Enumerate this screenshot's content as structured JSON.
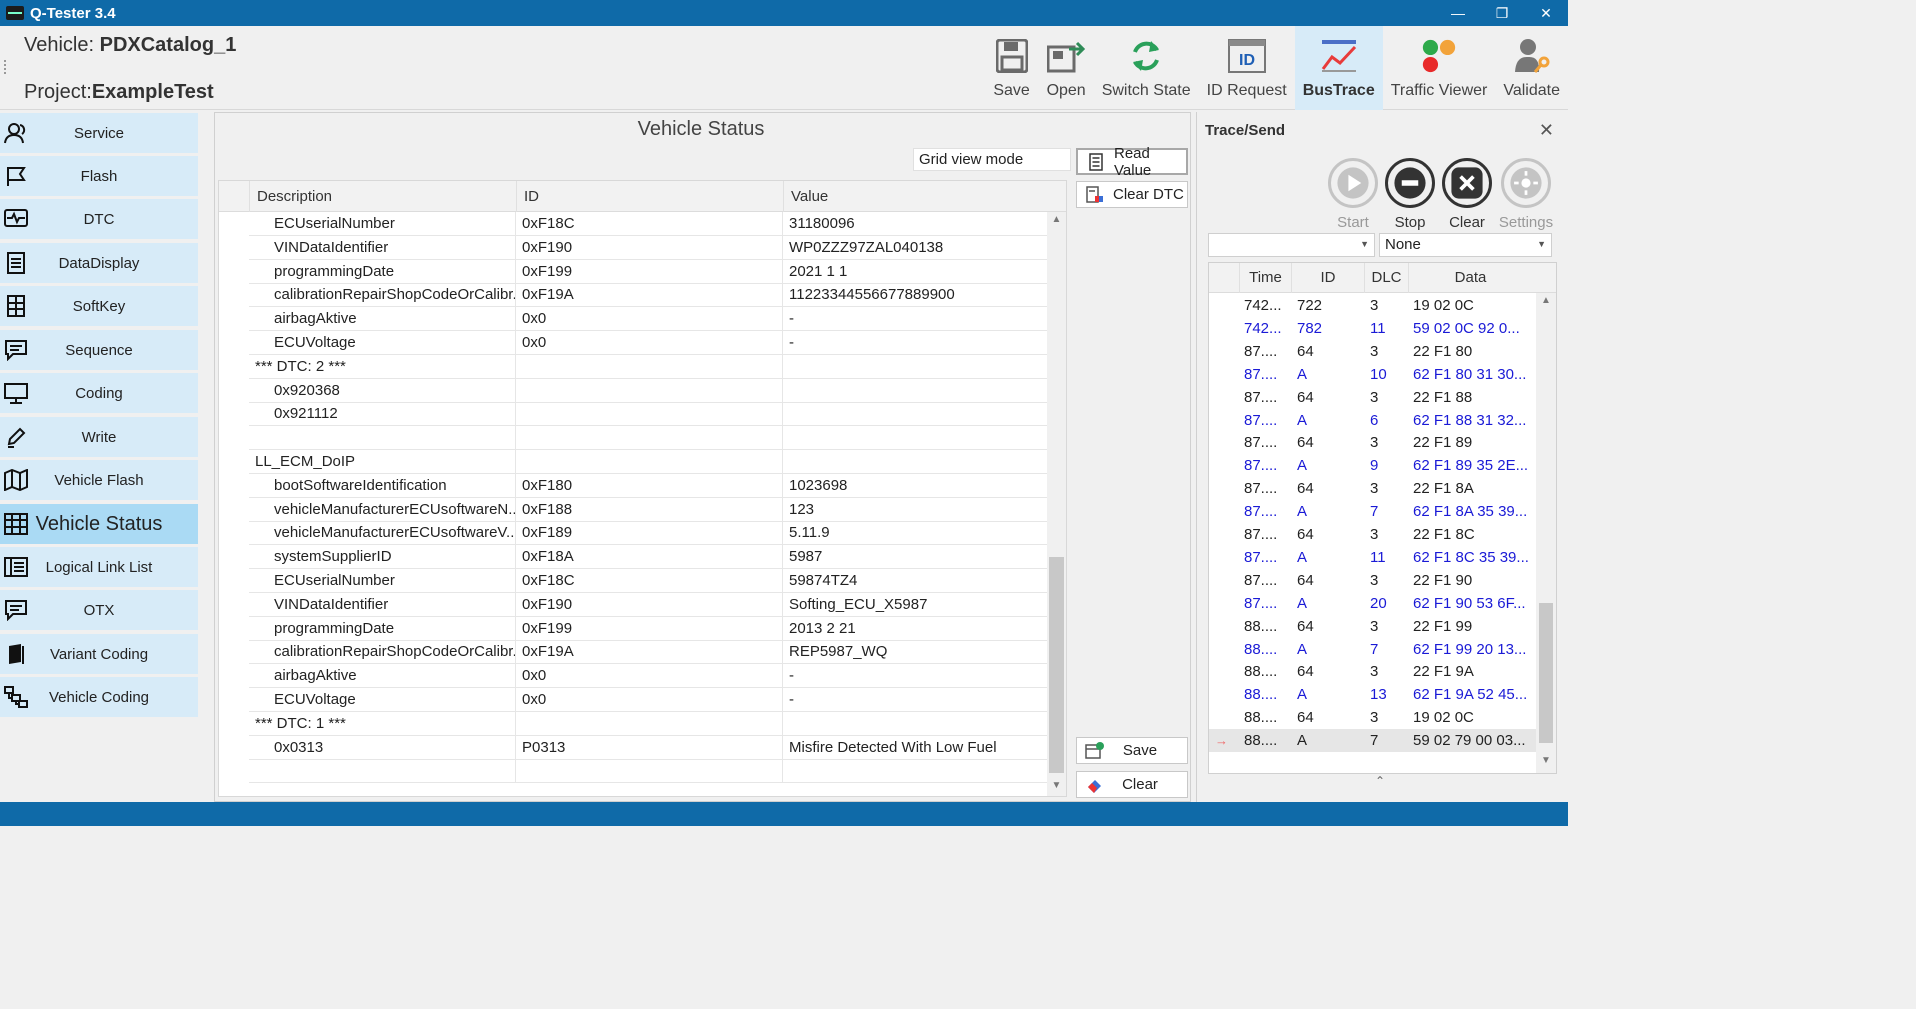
{
  "window": {
    "title": "Q-Tester  3.4"
  },
  "header": {
    "vehicle_label": "Vehicle: ",
    "vehicle_name": "PDXCatalog_1",
    "project_label": "Project:",
    "project_name": "ExampleTest"
  },
  "toolbar": [
    {
      "label": "Save",
      "icon": "floppy-icon"
    },
    {
      "label": "Open",
      "icon": "open-folder-icon"
    },
    {
      "label": "Switch State",
      "icon": "refresh-icon"
    },
    {
      "label": "ID Request",
      "icon": "id-card-icon"
    },
    {
      "label": "BusTrace",
      "icon": "bus-trace-icon",
      "active": true
    },
    {
      "label": "Traffic Viewer",
      "icon": "traffic-light-icon"
    },
    {
      "label": "Validate",
      "icon": "user-key-icon"
    }
  ],
  "sidebar": {
    "items": [
      {
        "label": "Service",
        "icon": "user-group-icon"
      },
      {
        "label": "Flash",
        "icon": "flag-icon"
      },
      {
        "label": "DTC",
        "icon": "monitor-pulse-icon"
      },
      {
        "label": "DataDisplay",
        "icon": "document-icon"
      },
      {
        "label": "SoftKey",
        "icon": "keypad-icon"
      },
      {
        "label": "Sequence",
        "icon": "chat-bubble-icon"
      },
      {
        "label": "Coding",
        "icon": "monitor-icon"
      },
      {
        "label": "Write",
        "icon": "pencil-icon"
      },
      {
        "label": "Vehicle Flash",
        "icon": "map-icon"
      },
      {
        "label": "Vehicle Status",
        "icon": "grid-icon",
        "active": true
      },
      {
        "label": "Logical Link List",
        "icon": "list-icon"
      },
      {
        "label": "OTX",
        "icon": "chat-lines-icon"
      },
      {
        "label": "Variant Coding",
        "icon": "book-icon"
      },
      {
        "label": "Vehicle Coding",
        "icon": "hierarchy-icon"
      }
    ]
  },
  "vehicle_status": {
    "title": "Vehicle Status",
    "view_mode": "Grid view mode",
    "buttons": {
      "read_value": "Read Value",
      "clear_dtc": "Clear DTC",
      "save": "Save",
      "clear": "Clear"
    },
    "columns": [
      "Description",
      "ID",
      "Value"
    ],
    "rows": [
      {
        "description": "ECUserialNumber",
        "id": "0xF18C",
        "value": "31180096",
        "indent": true
      },
      {
        "description": "VINDataIdentifier",
        "id": "0xF190",
        "value": "WP0ZZZ97ZAL040138",
        "indent": true
      },
      {
        "description": "programmingDate",
        "id": "0xF199",
        "value": "2021 1 1",
        "indent": true
      },
      {
        "description": "calibrationRepairShopCodeOrCalibr...",
        "id": "0xF19A",
        "value": "11223344556677889900",
        "indent": true
      },
      {
        "description": "airbagAktive",
        "id": "0x0",
        "value": "-",
        "indent": true
      },
      {
        "description": "ECUVoltage",
        "id": "0x0",
        "value": "-",
        "indent": true
      },
      {
        "description": "*** DTC: 2 ***",
        "id": "",
        "value": "",
        "indent": false
      },
      {
        "description": "0x920368",
        "id": "",
        "value": "",
        "indent": true
      },
      {
        "description": "0x921112",
        "id": "",
        "value": "",
        "indent": true
      },
      {
        "description": "",
        "id": "",
        "value": "",
        "indent": false
      },
      {
        "description": "LL_ECM_DoIP",
        "id": "",
        "value": "",
        "indent": false
      },
      {
        "description": "bootSoftwareIdentification",
        "id": "0xF180",
        "value": "1023698",
        "indent": true
      },
      {
        "description": "vehicleManufacturerECUsoftwareN...",
        "id": "0xF188",
        "value": "123",
        "indent": true
      },
      {
        "description": "vehicleManufacturerECUsoftwareV...",
        "id": "0xF189",
        "value": "5.11.9",
        "indent": true
      },
      {
        "description": "systemSupplierID",
        "id": "0xF18A",
        "value": "5987",
        "indent": true
      },
      {
        "description": "ECUserialNumber",
        "id": "0xF18C",
        "value": "59874TZ4",
        "indent": true
      },
      {
        "description": "VINDataIdentifier",
        "id": "0xF190",
        "value": "Softing_ECU_X5987",
        "indent": true
      },
      {
        "description": "programmingDate",
        "id": "0xF199",
        "value": "2013 2 21",
        "indent": true
      },
      {
        "description": "calibrationRepairShopCodeOrCalibr...",
        "id": "0xF19A",
        "value": "REP5987_WQ",
        "indent": true
      },
      {
        "description": "airbagAktive",
        "id": "0x0",
        "value": "-",
        "indent": true
      },
      {
        "description": "ECUVoltage",
        "id": "0x0",
        "value": "-",
        "indent": true
      },
      {
        "description": "*** DTC: 1 ***",
        "id": "",
        "value": "",
        "indent": false
      },
      {
        "description": "0x0313",
        "id": "P0313",
        "value": "Misfire Detected With Low Fuel",
        "indent": true
      },
      {
        "description": "",
        "id": "",
        "value": "",
        "indent": false
      }
    ]
  },
  "trace": {
    "title": "Trace/Send",
    "close_icon": "close-icon",
    "buttons": [
      {
        "label": "Start",
        "icon": "play-icon",
        "enabled": false
      },
      {
        "label": "Stop",
        "icon": "stop-icon",
        "enabled": true
      },
      {
        "label": "Clear",
        "icon": "clear-x-icon",
        "enabled": true
      },
      {
        "label": "Settings",
        "icon": "gear-icon",
        "enabled": false
      }
    ],
    "filter_left": "",
    "filter_right": "None",
    "columns": [
      "Time",
      "ID",
      "DLC",
      "Data"
    ],
    "rows": [
      {
        "time": "742...",
        "id": "722",
        "dlc": "3",
        "data": "19 02 0C",
        "rx": false
      },
      {
        "time": "742...",
        "id": "782",
        "dlc": "11",
        "data": "59 02 0C 92 0...",
        "rx": true
      },
      {
        "time": "87....",
        "id": "64",
        "dlc": "3",
        "data": "22 F1 80",
        "rx": false
      },
      {
        "time": "87....",
        "id": "A",
        "dlc": "10",
        "data": "62 F1 80 31 30...",
        "rx": true
      },
      {
        "time": "87....",
        "id": "64",
        "dlc": "3",
        "data": "22 F1 88",
        "rx": false
      },
      {
        "time": "87....",
        "id": "A",
        "dlc": "6",
        "data": "62 F1 88 31 32...",
        "rx": true
      },
      {
        "time": "87....",
        "id": "64",
        "dlc": "3",
        "data": "22 F1 89",
        "rx": false
      },
      {
        "time": "87....",
        "id": "A",
        "dlc": "9",
        "data": "62 F1 89 35 2E...",
        "rx": true
      },
      {
        "time": "87....",
        "id": "64",
        "dlc": "3",
        "data": "22 F1 8A",
        "rx": false
      },
      {
        "time": "87....",
        "id": "A",
        "dlc": "7",
        "data": "62 F1 8A 35 39...",
        "rx": true
      },
      {
        "time": "87....",
        "id": "64",
        "dlc": "3",
        "data": "22 F1 8C",
        "rx": false
      },
      {
        "time": "87....",
        "id": "A",
        "dlc": "11",
        "data": "62 F1 8C 35 39...",
        "rx": true
      },
      {
        "time": "87....",
        "id": "64",
        "dlc": "3",
        "data": "22 F1 90",
        "rx": false
      },
      {
        "time": "87....",
        "id": "A",
        "dlc": "20",
        "data": "62 F1 90 53 6F...",
        "rx": true
      },
      {
        "time": "88....",
        "id": "64",
        "dlc": "3",
        "data": "22 F1 99",
        "rx": false
      },
      {
        "time": "88....",
        "id": "A",
        "dlc": "7",
        "data": "62 F1 99 20 13...",
        "rx": true
      },
      {
        "time": "88....",
        "id": "64",
        "dlc": "3",
        "data": "22 F1 9A",
        "rx": false
      },
      {
        "time": "88....",
        "id": "A",
        "dlc": "13",
        "data": "62 F1 9A 52 45...",
        "rx": true
      },
      {
        "time": "88....",
        "id": "64",
        "dlc": "3",
        "data": "19 02 0C",
        "rx": false
      },
      {
        "time": "88....",
        "id": "A",
        "dlc": "7",
        "data": "59 02 79 00 03...",
        "rx": false,
        "selected": true
      }
    ]
  },
  "colors": {
    "title_bar": "#0f6aa8",
    "sidebar_item": "#d7ebf8",
    "sidebar_active": "#aadaf4",
    "rx_text": "#1a1ad6"
  }
}
